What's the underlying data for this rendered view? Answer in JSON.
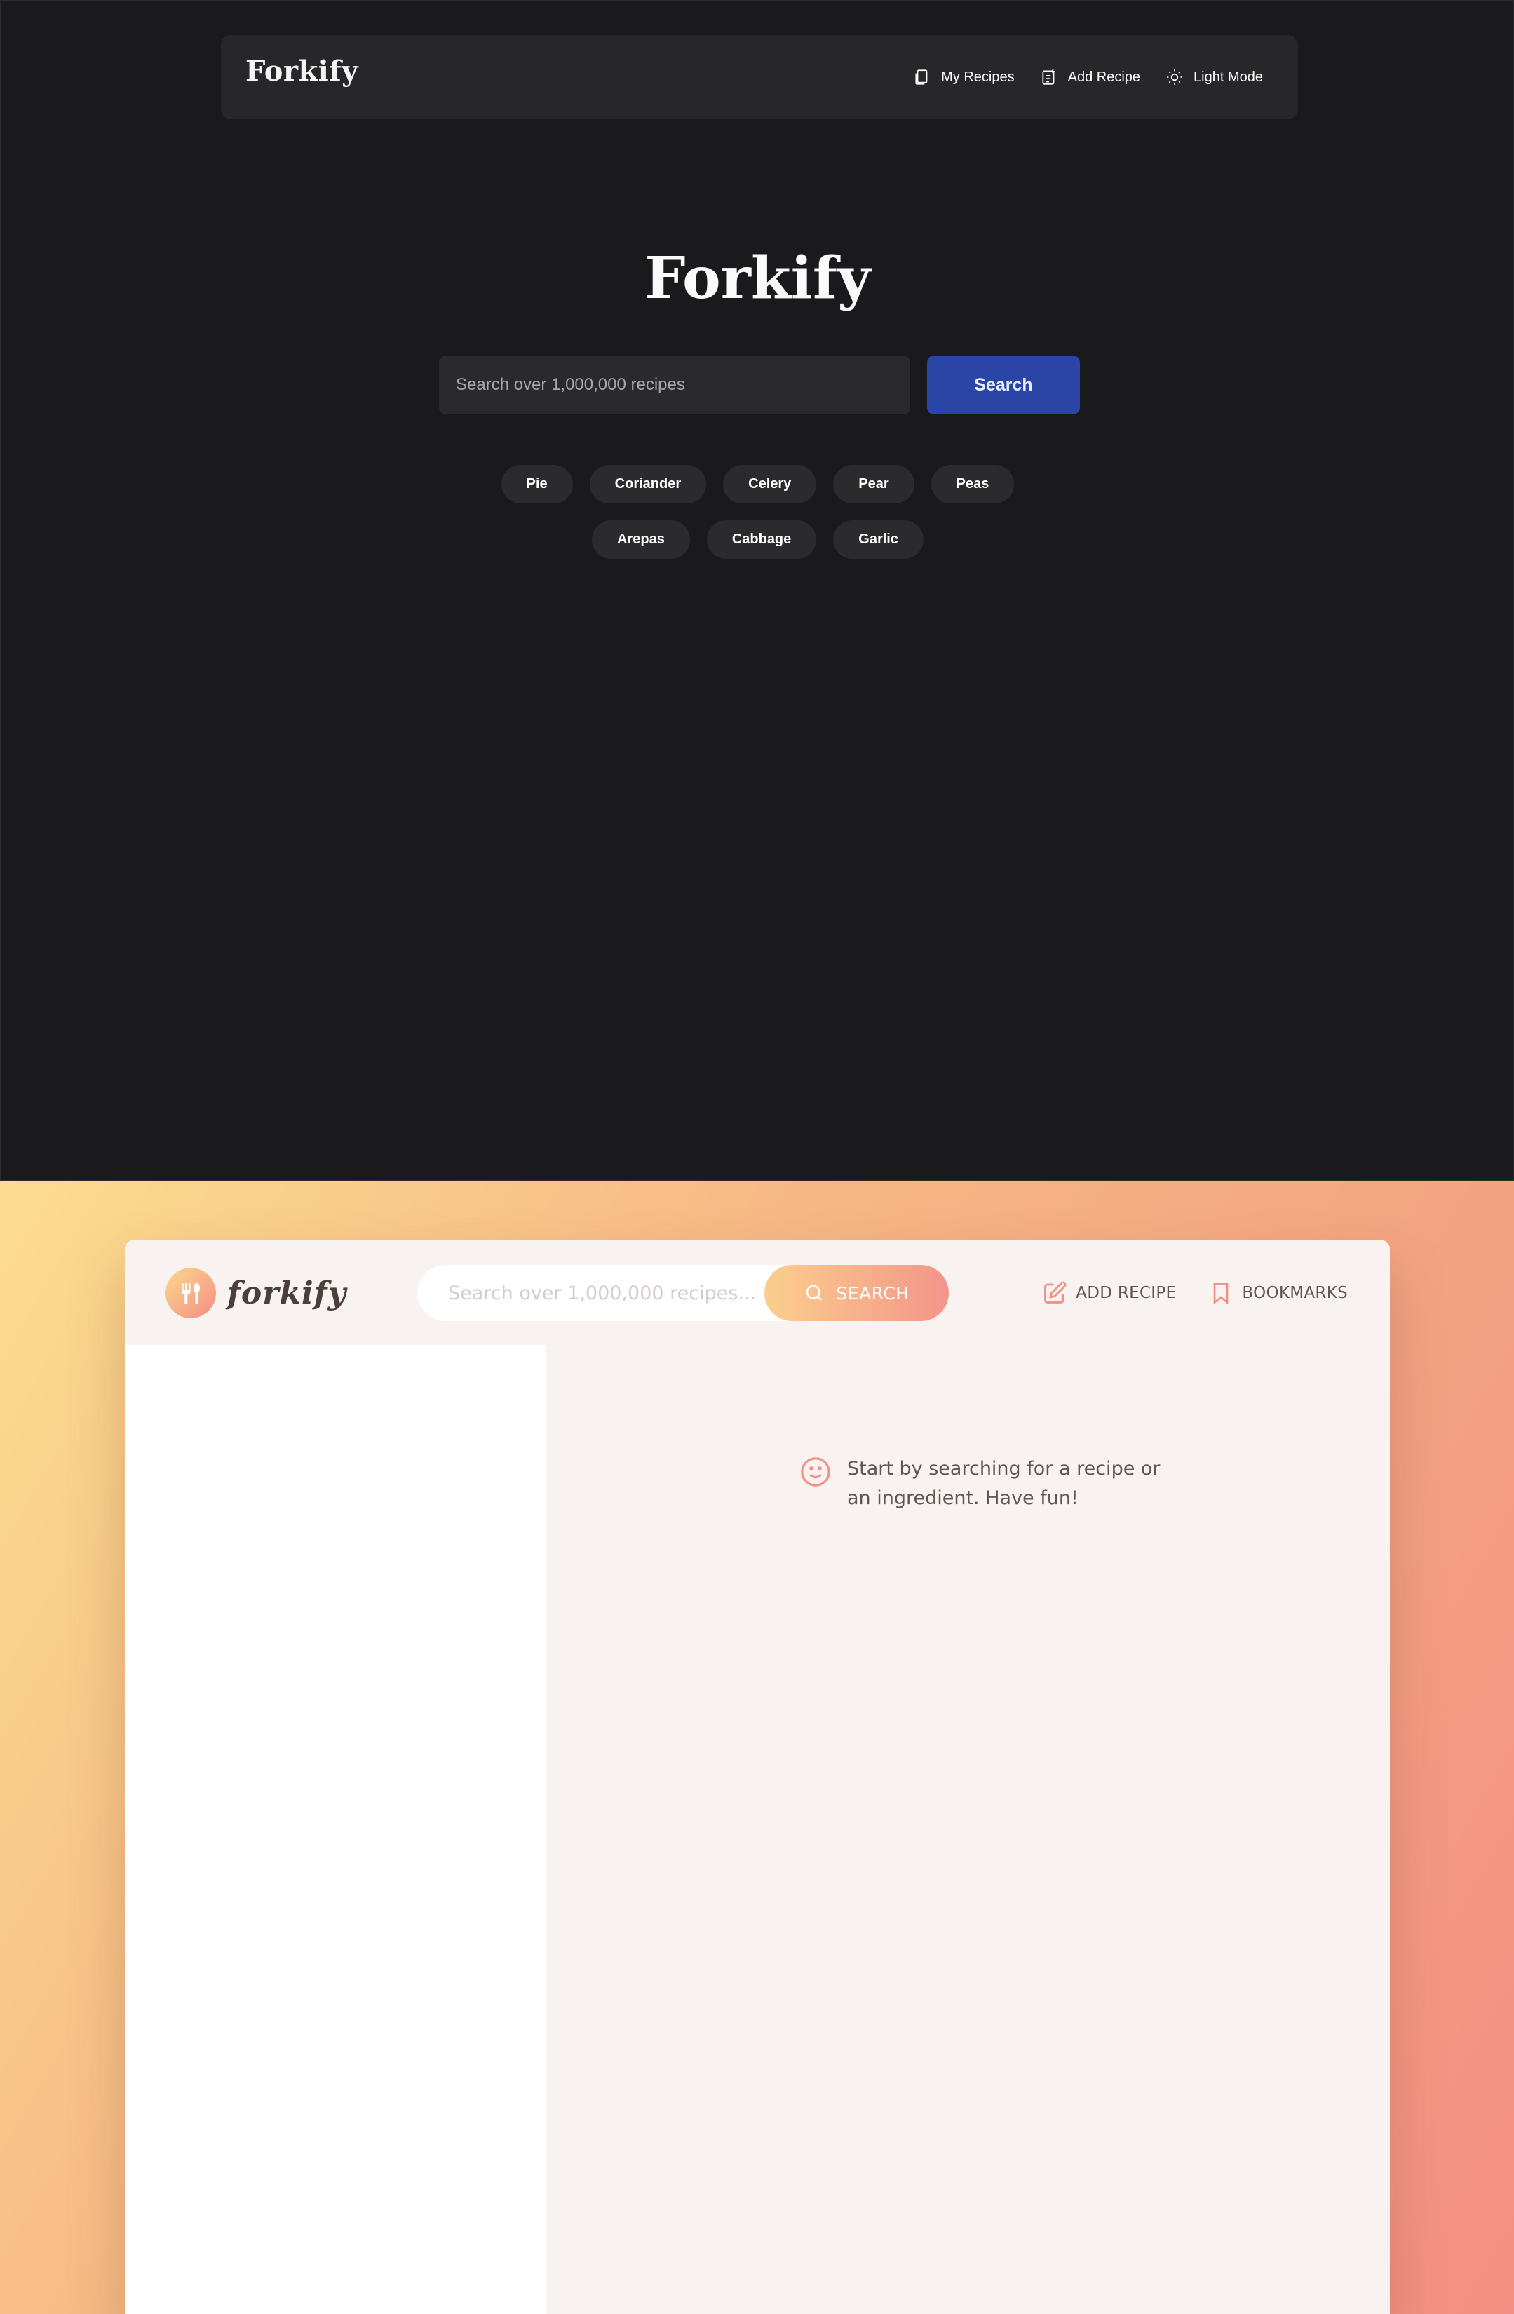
{
  "dark_app": {
    "nav": {
      "logo": "Forkify",
      "links": [
        {
          "label": "My Recipes",
          "icon": "bookmark-copy-icon"
        },
        {
          "label": "Add Recipe",
          "icon": "note-add-icon"
        },
        {
          "label": "Light Mode",
          "icon": "sun-icon"
        }
      ]
    },
    "title": "Forkify",
    "search": {
      "placeholder": "Search over 1,000,000 recipes",
      "button_label": "Search"
    },
    "suggestions_row1": [
      "Pie",
      "Coriander",
      "Celery",
      "Pear",
      "Peas"
    ],
    "suggestions_row2": [
      "Arepas",
      "Cabbage",
      "Garlic"
    ],
    "colors": {
      "background": "#1a1a1c",
      "accent": "#2a45a5"
    }
  },
  "warm_app": {
    "logo_text": "forkify",
    "search": {
      "placeholder": "Search over 1,000,000 recipes...",
      "button_label": "SEARCH"
    },
    "nav": {
      "add_recipe": "ADD RECIPE",
      "bookmarks": "BOOKMARKS"
    },
    "message": "Start by searching for a recipe or an ingredient. Have fun!",
    "colors": {
      "gradient_start": "#fbdb89",
      "gradient_end": "#f48982",
      "text": "#615551"
    }
  }
}
